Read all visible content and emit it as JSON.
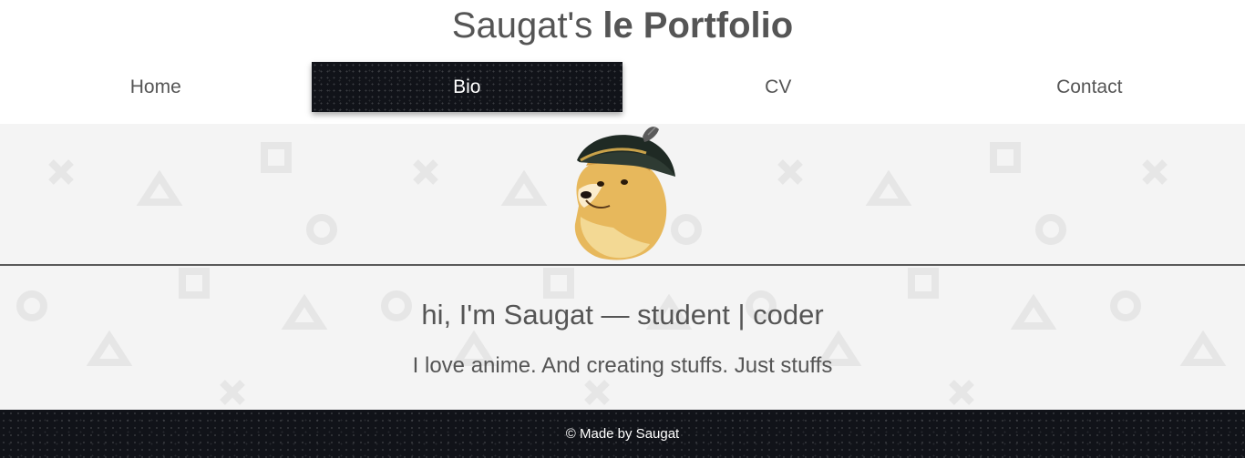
{
  "header": {
    "title_regular": "Saugat's",
    "title_bold": "le Portfolio"
  },
  "nav": {
    "items": [
      {
        "label": "Home",
        "active": false
      },
      {
        "label": "Bio",
        "active": true
      },
      {
        "label": "CV",
        "active": false
      },
      {
        "label": "Contact",
        "active": false
      }
    ]
  },
  "hero": {
    "avatar_icon": "doge-pirate-hat-image",
    "tagline": "hi, I'm Saugat — student | coder",
    "subline": "I love anime. And creating stuffs. Just stuffs"
  },
  "footer": {
    "text": "© Made by Saugat"
  },
  "colors": {
    "text": "#555555",
    "dark": "#111319",
    "hero_bg": "#f4f4f4",
    "shapes": "#e6e6e6"
  }
}
